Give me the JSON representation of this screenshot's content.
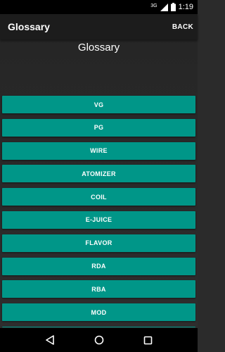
{
  "status_bar": {
    "time": "1:19",
    "network": "3G",
    "icons": [
      "network-3g-icon",
      "signal-icon",
      "battery-icon"
    ]
  },
  "app_bar": {
    "title": "Glossary",
    "back_label": "BACK"
  },
  "content": {
    "heading": "Glossary",
    "terms": [
      "VG",
      "PG",
      "WIRE",
      "ATOMIZER",
      "COIL",
      "E-JUICE",
      "FLAVOR",
      "RDA",
      "RBA",
      "MOD",
      ""
    ]
  },
  "nav_bar": {
    "icons": [
      "back-icon",
      "home-icon",
      "recents-icon"
    ]
  },
  "colors": {
    "accent": "#009688",
    "app_bar": "#1c1c1c",
    "background": "#2b2b2b"
  }
}
